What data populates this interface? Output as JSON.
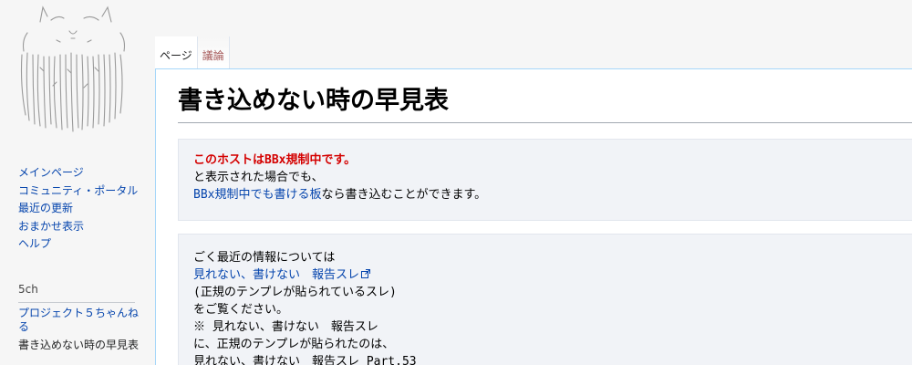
{
  "sidebar": {
    "nav_main": [
      {
        "label": "メインページ"
      },
      {
        "label": "コミュニティ・ポータル"
      },
      {
        "label": "最近の更新"
      },
      {
        "label": "おまかせ表示"
      },
      {
        "label": "ヘルプ"
      }
    ],
    "section_heading": "5ch",
    "nav_5ch": [
      {
        "label": "プロジェクト５ちゃんねる"
      },
      {
        "label": "書き込めない時の早見表"
      }
    ]
  },
  "tabs": [
    {
      "label": "ページ"
    },
    {
      "label": "議論"
    }
  ],
  "page": {
    "title": "書き込めない時の早見表"
  },
  "box1": {
    "line1": "このホストはBBx規制中です。",
    "line2": "と表示された場合でも、",
    "line3_link": "BBx規制中でも書ける板",
    "line3_rest": "なら書き込むことができます。"
  },
  "box2": {
    "line1": "ごく最近の情報については",
    "line2_link": "見れない、書けない　報告スレ",
    "line3": "(正規のテンプレが貼られているスレ)",
    "line4": "をご覧ください。",
    "line5": "※ 見れない、書けない　報告スレ",
    "line6": "に、正規のテンプレが貼られたのは、",
    "line7": "見れない、書けない　報告スレ Part.53"
  },
  "icons": {
    "external_link": "external-link-icon",
    "logo": "cat-logo"
  },
  "colors": {
    "link": "#0645ad",
    "warning": "#d40000",
    "talk_tab": "#a55858",
    "border_blue": "#a7d7f9"
  }
}
